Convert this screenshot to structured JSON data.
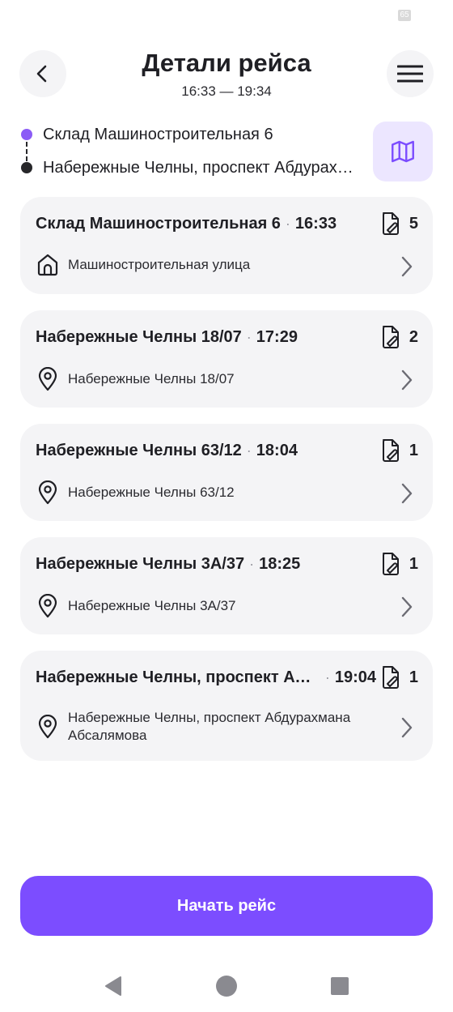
{
  "status_bar": {
    "battery": "65"
  },
  "header": {
    "title": "Детали рейса",
    "time_range": "16:33 — 19:34"
  },
  "route": {
    "from": "Склад Машиностроительная 6",
    "to": "Набережные Челны, проспект Абдурахмана Абсалямова"
  },
  "stops": [
    {
      "name": "Склад Машиностроительная 6",
      "separator": "·",
      "time": "16:33",
      "docs": "5",
      "address": "Машиностроительная улица",
      "icon": "home-icon"
    },
    {
      "name": "Набережные Челны 18/07",
      "separator": "·",
      "time": "17:29",
      "docs": "2",
      "address": "Набережные Челны 18/07",
      "icon": "location-pin-icon"
    },
    {
      "name": "Набережные Челны 63/12",
      "separator": "·",
      "time": "18:04",
      "docs": "1",
      "address": "Набережные Челны 63/12",
      "icon": "location-pin-icon"
    },
    {
      "name": "Набережные Челны 3А/37",
      "separator": "·",
      "time": "18:25",
      "docs": "1",
      "address": "Набережные Челны 3А/37",
      "icon": "location-pin-icon"
    },
    {
      "name": "Набережные Челны, проспект Абдурахмана Абсалямова",
      "separator": "·",
      "time": "19:04",
      "docs": "1",
      "address": "Набережные Челны, проспект Абдурахмана Абсалямова",
      "icon": "location-pin-icon"
    }
  ],
  "actions": {
    "start_label": "Начать рейс"
  },
  "colors": {
    "accent": "#7c4dff",
    "accent_light": "#ece6ff",
    "card_bg": "#f4f4f6",
    "route_start": "#8b5cf6"
  }
}
